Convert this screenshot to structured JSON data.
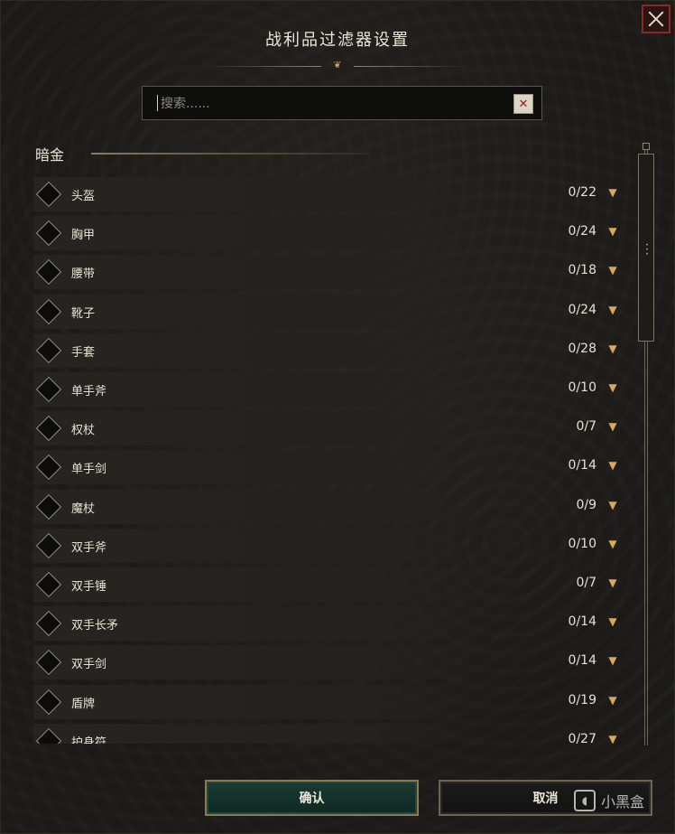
{
  "dialog": {
    "title": "战利品过滤器设置"
  },
  "search": {
    "placeholder": "搜索......",
    "value": ""
  },
  "section": {
    "title": "暗金"
  },
  "items": [
    {
      "label": "头盔",
      "count": "0/22"
    },
    {
      "label": "胸甲",
      "count": "0/24"
    },
    {
      "label": "腰带",
      "count": "0/18"
    },
    {
      "label": "靴子",
      "count": "0/24"
    },
    {
      "label": "手套",
      "count": "0/28"
    },
    {
      "label": "单手斧",
      "count": "0/10"
    },
    {
      "label": "权杖",
      "count": "0/7"
    },
    {
      "label": "单手剑",
      "count": "0/14"
    },
    {
      "label": "魔杖",
      "count": "0/9"
    },
    {
      "label": "双手斧",
      "count": "0/10"
    },
    {
      "label": "双手锤",
      "count": "0/7"
    },
    {
      "label": "双手长矛",
      "count": "0/14"
    },
    {
      "label": "双手剑",
      "count": "0/14"
    },
    {
      "label": "盾牌",
      "count": "0/19"
    },
    {
      "label": "护身符",
      "count": "0/27"
    }
  ],
  "buttons": {
    "confirm": "确认",
    "cancel": "取消"
  },
  "watermark": {
    "text": "小黑盒"
  },
  "icons": {
    "close": "close-icon",
    "clear": "clear-search-icon",
    "expand": "chevron-down-icon",
    "checkbox": "diamond-checkbox-icon"
  },
  "colors": {
    "accent_gold": "#c9a660",
    "confirm_bg": "#1a3a33",
    "close_border": "#8a2a22",
    "arrow": "#d9a858"
  }
}
